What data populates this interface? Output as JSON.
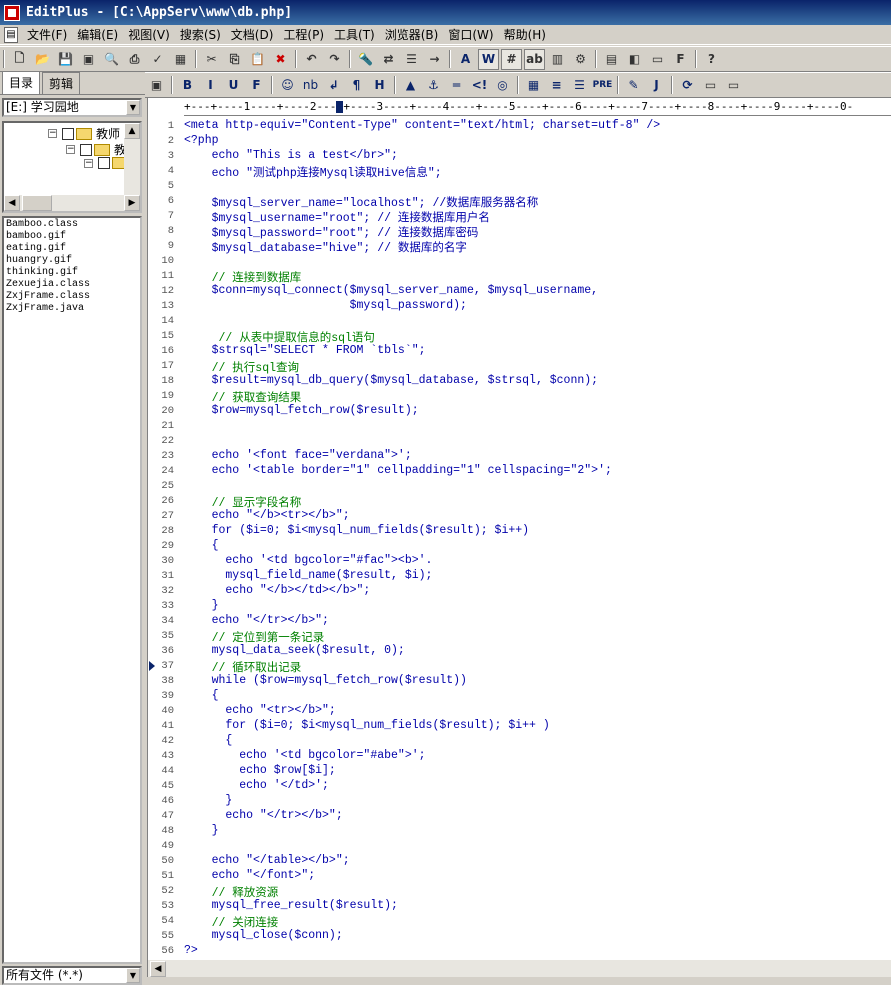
{
  "window": {
    "title": "EditPlus - [C:\\AppServ\\www\\db.php]"
  },
  "menu": [
    "文件(F)",
    "编辑(E)",
    "视图(V)",
    "搜索(S)",
    "文档(D)",
    "工程(P)",
    "工具(T)",
    "浏览器(B)",
    "窗口(W)",
    "帮助(H)"
  ],
  "toolbar1": [
    "new-file",
    "open",
    "save",
    "save-all",
    "print-preview",
    "print",
    "spellcheck",
    "properties",
    "cut",
    "copy",
    "paste",
    "delete",
    "undo",
    "redo",
    "find",
    "replace",
    "find-in-files",
    "goto-line",
    "font",
    "word-wrap",
    "line-numbers",
    "ruler",
    "column-select",
    "settings",
    "split-window",
    "browser-view",
    "full-screen",
    "user-tools",
    "help"
  ],
  "toolbar2": [
    "B",
    "I",
    "U",
    "F",
    "Color",
    "nb",
    "↲",
    "¶",
    "H",
    "Img",
    "Anchor",
    "HR",
    "Comment",
    "Form",
    "Table",
    "Center",
    "Justify",
    "PRE",
    "Style",
    "JS",
    "Dir"
  ],
  "left_panel": {
    "tabs": [
      "目录",
      "剪辑"
    ],
    "drive": "[E:] 学习园地",
    "tree": [
      {
        "label": "教师",
        "level": 0
      },
      {
        "label": "教",
        "level": 1
      },
      {
        "label": "",
        "level": 2
      }
    ],
    "files": [
      "Bamboo.class",
      "bamboo.gif",
      "eating.gif",
      "huangry.gif",
      "thinking.gif",
      "Zexuejia.class",
      "ZxjFrame.class",
      "ZxjFrame.java"
    ],
    "filter": "所有文件 (*.*)"
  },
  "editor": {
    "ruler": "+---+----1----+----2---",
    "ruler_after": "+----3----+----4----+----5----+----6----+----7----+----8----+----9----+----0-",
    "lines": [
      {
        "n": "1",
        "t": "<meta http-equiv=\"Content-Type\" content=\"text/html; charset=utf-8\" />",
        "k": "code"
      },
      {
        "n": "2",
        "t": "<?php",
        "k": "code"
      },
      {
        "n": "3",
        "t": "    echo \"This is a test</br>\";",
        "k": "code"
      },
      {
        "n": "4",
        "t": "    echo \"测试php连接Mysql读取Hive信息\";",
        "k": "code"
      },
      {
        "n": "5",
        "t": "",
        "k": "code"
      },
      {
        "n": "6",
        "t": "    $mysql_server_name=\"localhost\"; //数据库服务器名称",
        "k": "code"
      },
      {
        "n": "7",
        "t": "    $mysql_username=\"root\"; // 连接数据库用户名",
        "k": "code"
      },
      {
        "n": "8",
        "t": "    $mysql_password=\"root\"; // 连接数据库密码",
        "k": "code"
      },
      {
        "n": "9",
        "t": "    $mysql_database=\"hive\"; // 数据库的名字",
        "k": "code"
      },
      {
        "n": "10",
        "t": "",
        "k": "code"
      },
      {
        "n": "11",
        "t": "    // 连接到数据库",
        "k": "comment"
      },
      {
        "n": "12",
        "t": "    $conn=mysql_connect($mysql_server_name, $mysql_username,",
        "k": "code"
      },
      {
        "n": "13",
        "t": "                        $mysql_password);",
        "k": "code"
      },
      {
        "n": "14",
        "t": "",
        "k": "code"
      },
      {
        "n": "15",
        "t": "     // 从表中提取信息的sql语句",
        "k": "comment"
      },
      {
        "n": "16",
        "t": "    $strsql=\"SELECT * FROM `tbls`\";",
        "k": "code"
      },
      {
        "n": "17",
        "t": "    // 执行sql查询",
        "k": "comment"
      },
      {
        "n": "18",
        "t": "    $result=mysql_db_query($mysql_database, $strsql, $conn);",
        "k": "code"
      },
      {
        "n": "19",
        "t": "    // 获取查询结果",
        "k": "comment"
      },
      {
        "n": "20",
        "t": "    $row=mysql_fetch_row($result);",
        "k": "code"
      },
      {
        "n": "21",
        "t": "",
        "k": "code"
      },
      {
        "n": "22",
        "t": "",
        "k": "code"
      },
      {
        "n": "23",
        "t": "    echo '<font face=\"verdana\">';",
        "k": "code"
      },
      {
        "n": "24",
        "t": "    echo '<table border=\"1\" cellpadding=\"1\" cellspacing=\"2\">';",
        "k": "code"
      },
      {
        "n": "25",
        "t": "",
        "k": "code"
      },
      {
        "n": "26",
        "t": "    // 显示字段名称",
        "k": "comment"
      },
      {
        "n": "27",
        "t": "    echo \"</b><tr></b>\";",
        "k": "code"
      },
      {
        "n": "28",
        "t": "    for ($i=0; $i<mysql_num_fields($result); $i++)",
        "k": "code"
      },
      {
        "n": "29",
        "t": "    {",
        "k": "code"
      },
      {
        "n": "30",
        "t": "      echo '<td bgcolor=\"#fac\"><b>'.",
        "k": "code"
      },
      {
        "n": "31",
        "t": "      mysql_field_name($result, $i);",
        "k": "code"
      },
      {
        "n": "32",
        "t": "      echo \"</b></td></b>\";",
        "k": "code"
      },
      {
        "n": "33",
        "t": "    }",
        "k": "code"
      },
      {
        "n": "34",
        "t": "    echo \"</tr></b>\";",
        "k": "code"
      },
      {
        "n": "35",
        "t": "    // 定位到第一条记录",
        "k": "comment"
      },
      {
        "n": "36",
        "t": "    mysql_data_seek($result, 0);",
        "k": "code"
      },
      {
        "n": "37",
        "t": "    // 循环取出记录",
        "k": "comment"
      },
      {
        "n": "38",
        "t": "    while ($row=mysql_fetch_row($result))",
        "k": "code"
      },
      {
        "n": "39",
        "t": "    {",
        "k": "code"
      },
      {
        "n": "40",
        "t": "      echo \"<tr></b>\";",
        "k": "code"
      },
      {
        "n": "41",
        "t": "      for ($i=0; $i<mysql_num_fields($result); $i++ )",
        "k": "code"
      },
      {
        "n": "42",
        "t": "      {",
        "k": "code"
      },
      {
        "n": "43",
        "t": "        echo '<td bgcolor=\"#abe\">';",
        "k": "code"
      },
      {
        "n": "44",
        "t": "        echo $row[$i];",
        "k": "code"
      },
      {
        "n": "45",
        "t": "        echo '</td>';",
        "k": "code"
      },
      {
        "n": "46",
        "t": "      }",
        "k": "code"
      },
      {
        "n": "47",
        "t": "      echo \"</tr></b>\";",
        "k": "code"
      },
      {
        "n": "48",
        "t": "    }",
        "k": "code"
      },
      {
        "n": "49",
        "t": "",
        "k": "code"
      },
      {
        "n": "50",
        "t": "    echo \"</table></b>\";",
        "k": "code"
      },
      {
        "n": "51",
        "t": "    echo \"</font>\";",
        "k": "code"
      },
      {
        "n": "52",
        "t": "    // 释放资源",
        "k": "comment"
      },
      {
        "n": "53",
        "t": "    mysql_free_result($result);",
        "k": "code"
      },
      {
        "n": "54",
        "t": "    // 关闭连接",
        "k": "comment"
      },
      {
        "n": "55",
        "t": "    mysql_close($conn);",
        "k": "code"
      },
      {
        "n": "56",
        "t": "?>",
        "k": "code"
      }
    ],
    "current_line": 37
  }
}
